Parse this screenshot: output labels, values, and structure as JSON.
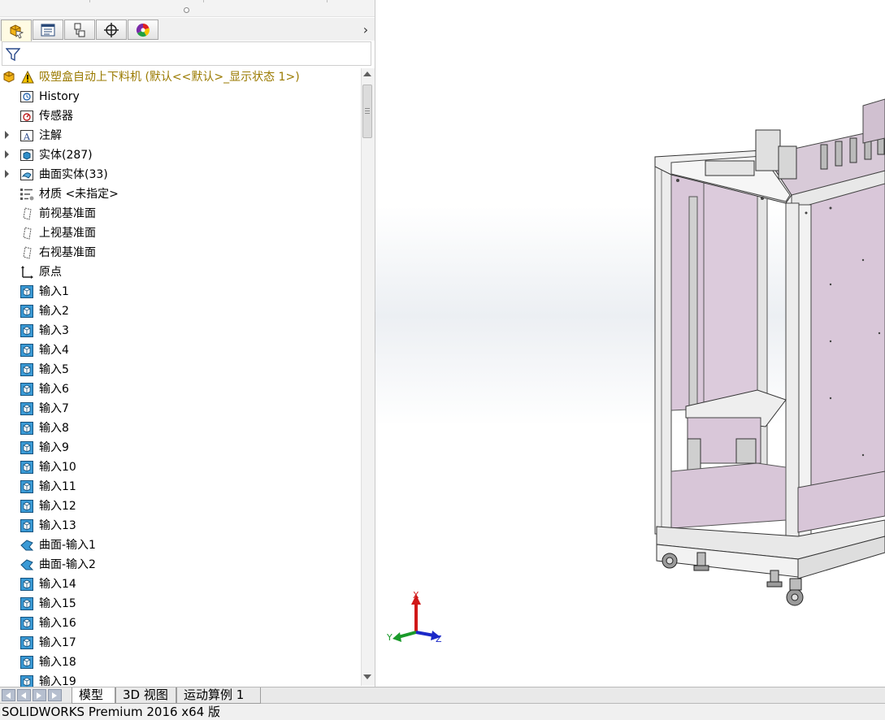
{
  "tree": {
    "root": "吸塑盒自动上下料机  (默认<<默认>_显示状态 1>)",
    "items": [
      {
        "label": "History",
        "icon": "history-icon",
        "expand": false
      },
      {
        "label": "传感器",
        "icon": "sensor-icon",
        "expand": false
      },
      {
        "label": "注解",
        "icon": "annotation-icon",
        "expand": true
      },
      {
        "label": "实体(287)",
        "icon": "solid-bodies-icon",
        "expand": true
      },
      {
        "label": "曲面实体(33)",
        "icon": "surface-bodies-icon",
        "expand": true
      },
      {
        "label": "材质 <未指定>",
        "icon": "material-icon",
        "expand": false
      },
      {
        "label": "前视基准面",
        "icon": "plane-icon",
        "expand": false
      },
      {
        "label": "上视基准面",
        "icon": "plane-icon",
        "expand": false
      },
      {
        "label": "右视基准面",
        "icon": "plane-icon",
        "expand": false
      },
      {
        "label": "原点",
        "icon": "origin-icon",
        "expand": false
      },
      {
        "label": "输入1",
        "icon": "imported-body-icon",
        "expand": false
      },
      {
        "label": "输入2",
        "icon": "imported-body-icon",
        "expand": false
      },
      {
        "label": "输入3",
        "icon": "imported-body-icon",
        "expand": false
      },
      {
        "label": "输入4",
        "icon": "imported-body-icon",
        "expand": false
      },
      {
        "label": "输入5",
        "icon": "imported-body-icon",
        "expand": false
      },
      {
        "label": "输入6",
        "icon": "imported-body-icon",
        "expand": false
      },
      {
        "label": "输入7",
        "icon": "imported-body-icon",
        "expand": false
      },
      {
        "label": "输入8",
        "icon": "imported-body-icon",
        "expand": false
      },
      {
        "label": "输入9",
        "icon": "imported-body-icon",
        "expand": false
      },
      {
        "label": "输入10",
        "icon": "imported-body-icon",
        "expand": false
      },
      {
        "label": "输入11",
        "icon": "imported-body-icon",
        "expand": false
      },
      {
        "label": "输入12",
        "icon": "imported-body-icon",
        "expand": false
      },
      {
        "label": "输入13",
        "icon": "imported-body-icon",
        "expand": false
      },
      {
        "label": "曲面-输入1",
        "icon": "imported-surface-icon",
        "expand": false
      },
      {
        "label": "曲面-输入2",
        "icon": "imported-surface-icon",
        "expand": false
      },
      {
        "label": "输入14",
        "icon": "imported-body-icon",
        "expand": false
      },
      {
        "label": "输入15",
        "icon": "imported-body-icon",
        "expand": false
      },
      {
        "label": "输入16",
        "icon": "imported-body-icon",
        "expand": false
      },
      {
        "label": "输入17",
        "icon": "imported-body-icon",
        "expand": false
      },
      {
        "label": "输入18",
        "icon": "imported-body-icon",
        "expand": false
      },
      {
        "label": "输入19",
        "icon": "imported-body-icon",
        "expand": false
      }
    ]
  },
  "panel_tabs": [
    "featuremanager-tab-icon",
    "propertymanager-tab-icon",
    "configurationmanager-tab-icon",
    "dimxpert-tab-icon",
    "display-manager-tab-icon"
  ],
  "triad": {
    "x": "X",
    "y": "Y",
    "z": "Z"
  },
  "bottom_tabs": [
    {
      "label": "模型",
      "active": true
    },
    {
      "label": "3D 视图",
      "active": false
    },
    {
      "label": "运动算例 1",
      "active": false
    }
  ],
  "status": "SOLIDWORKS Premium 2016 x64 版",
  "colors": {
    "root_text": "#9a7a00",
    "part_panel": "#d8c6d8",
    "frame": "#e6e6e6",
    "body_icon": "#2f8ec9"
  }
}
